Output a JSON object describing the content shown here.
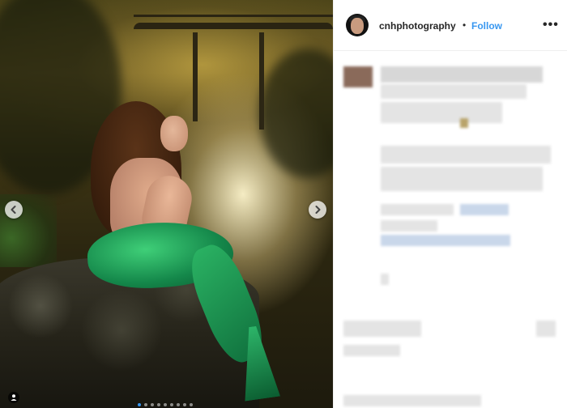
{
  "post": {
    "username": "cnhphotography",
    "separator": "•",
    "follow_label": "Follow",
    "more_label": "•••"
  },
  "carousel": {
    "dot_count": 9,
    "active_index": 0
  },
  "colors": {
    "follow_blue": "#3897f0",
    "username_text": "#262626",
    "divider": "#efefef"
  },
  "icons": {
    "prev": "chevron-left-icon",
    "next": "chevron-right-icon",
    "tag": "user-tag-icon",
    "more": "more-options-icon"
  }
}
